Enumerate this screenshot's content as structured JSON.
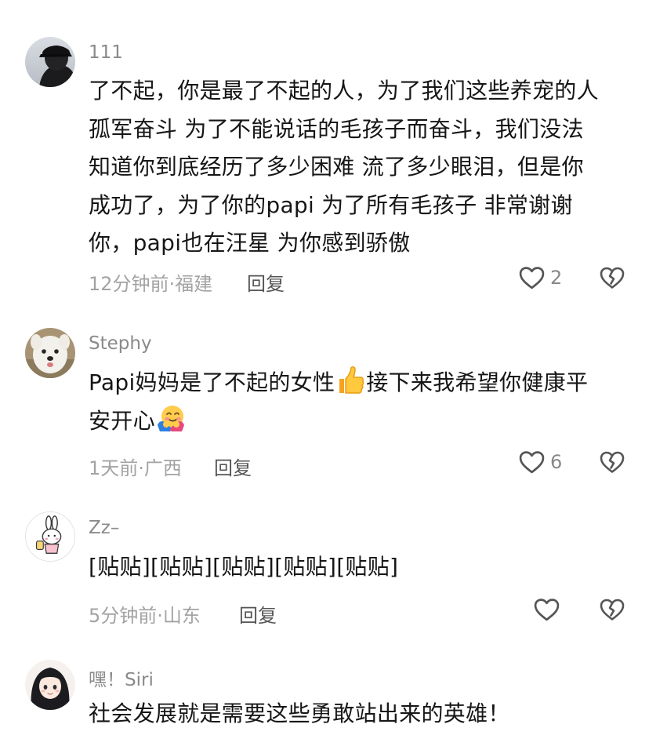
{
  "comments": [
    {
      "username": "111",
      "text_lines": [
        "了不起，你是最了不起的人，为了我们这些养宠的人",
        "孤军奋斗 为了不能说话的毛孩子而奋斗，我们没法",
        "知道你到底经历了多少困难 流了多少眼泪，但是你",
        "成功了，为了你的papi 为了所有毛孩子 非常谢谢",
        "你，papi也在汪星 为你感到骄傲"
      ],
      "time_location": "12分钟前·福建",
      "reply_label": "回复",
      "like_count": "2"
    },
    {
      "username": "Stephy",
      "text_line1_a": "Papi妈妈是了不起的女性",
      "text_line1_b": "接下来我希望你健康平",
      "text_line2": "安开心",
      "emoji_1": "thumbs-up-emoji",
      "emoji_2": "hugging-face-emoji",
      "time_location": "1天前·广西",
      "reply_label": "回复",
      "like_count": "6"
    },
    {
      "username": "Zz–",
      "text": "[贴贴][贴贴][贴贴][贴贴][贴贴]",
      "time_location": "5分钟前·山东",
      "reply_label": "回复",
      "like_count": ""
    },
    {
      "username": "嘿！Siri",
      "text": "社会发展就是需要这些勇敢站出来的英雄！"
    }
  ],
  "icons": {
    "like": "heart-outline-icon",
    "dislike": "broken-heart-icon"
  },
  "colors": {
    "text": "#161616",
    "username": "#8a8a8a",
    "meta": "#a3a3a3",
    "reply": "#555555",
    "icon": "#555555"
  }
}
